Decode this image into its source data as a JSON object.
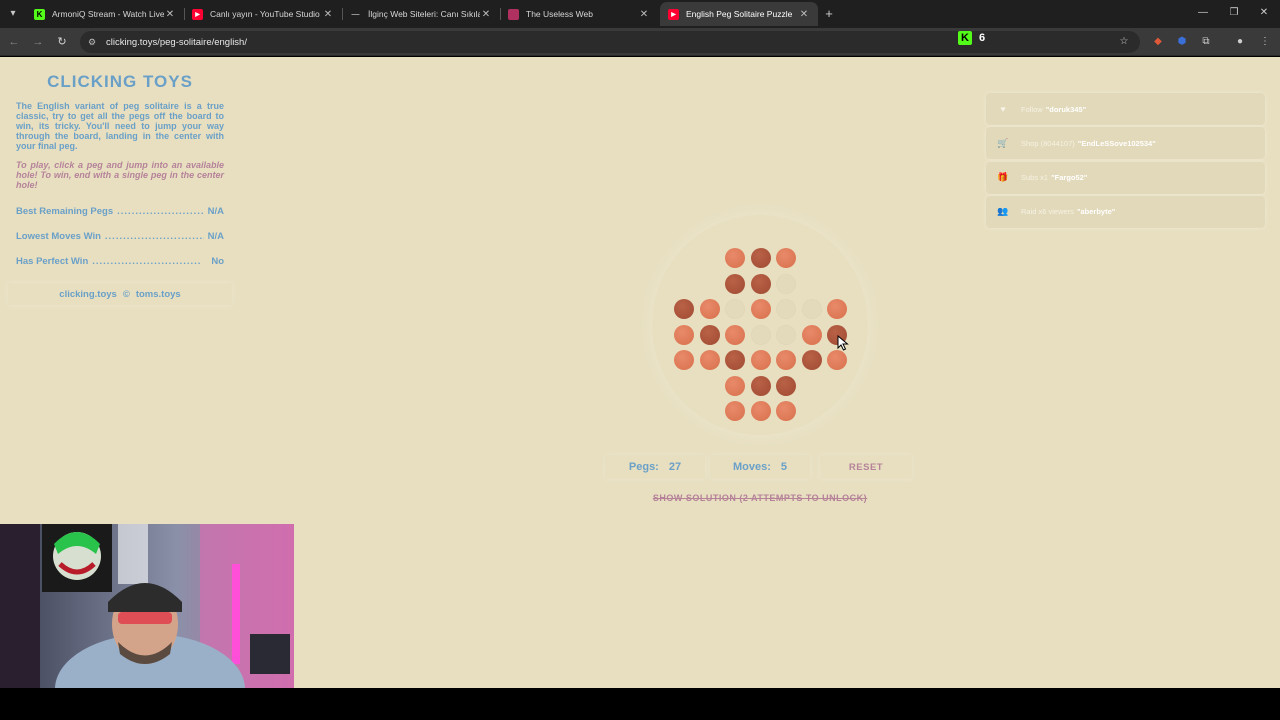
{
  "browser": {
    "tabs": [
      {
        "title": "ArmoniQ Stream - Watch Live o",
        "favicon": "kick",
        "active": false
      },
      {
        "title": "Canlı yayın - YouTube Studio",
        "favicon": "youtube",
        "active": false
      },
      {
        "title": "İlginç Web Siteleri: Canı Sıkılan",
        "favicon": "dash",
        "active": false
      },
      {
        "title": "The Useless Web",
        "favicon": "useless",
        "active": false
      },
      {
        "title": "English Peg Solitaire Puzzle",
        "favicon": "youtube",
        "active": true
      }
    ],
    "url": "clicking.toys/peg-solitaire/english/",
    "kick_badge_count": "6"
  },
  "sidebar": {
    "title": "CLICKING TOYS",
    "description": "The English variant of peg solitaire is a true classic, try to get all the pegs off the board to win, its tricky. You'll need to jump your way through the board, landing in the center with your final peg.",
    "instructions": "To play, click a peg and jump into an available hole! To win, end with a single peg in the center hole!",
    "stats": [
      {
        "label": "Best Remaining Pegs",
        "value": "N/A"
      },
      {
        "label": "Lowest Moves Win",
        "value": "N/A"
      },
      {
        "label": "Has Perfect Win",
        "value": "No"
      }
    ],
    "credit_site": "clicking.toys",
    "credit_sep": "©",
    "credit_author": "toms.toys"
  },
  "alerts": [
    {
      "icon": "heart-icon",
      "glyph": "♥",
      "text": "Follow",
      "highlight": "\"doruk345\""
    },
    {
      "icon": "cart-icon",
      "glyph": "🛒",
      "text": "Shop (8044107)",
      "highlight": "\"EndLeSSove102534\""
    },
    {
      "icon": "gift-icon",
      "glyph": "🎁",
      "text": "Subs x1",
      "highlight": "\"Fargo52\""
    },
    {
      "icon": "raid-icon",
      "glyph": "👥",
      "text": "Raid x6 viewers",
      "highlight": "\"aberbyte\""
    }
  ],
  "board": {
    "rows": [
      "..LDL..",
      "..DDE..",
      "DLELEEL",
      "LDLEELD",
      "LLDLLDL",
      "..LDD..",
      "..LLL.."
    ]
  },
  "controls": {
    "pegs_label": "Pegs:",
    "pegs_value": "27",
    "moves_label": "Moves:",
    "moves_value": "5",
    "reset_label": "RESET",
    "solution_label": "SHOW SOLUTION (2 ATTEMPTS TO UNLOCK)"
  },
  "colors": {
    "page_bg": "#e8dfc0",
    "accent_blue": "#6aa0c8",
    "accent_pink": "#b5829a",
    "peg_light": "#e07a58",
    "peg_dark": "#a84e36"
  }
}
